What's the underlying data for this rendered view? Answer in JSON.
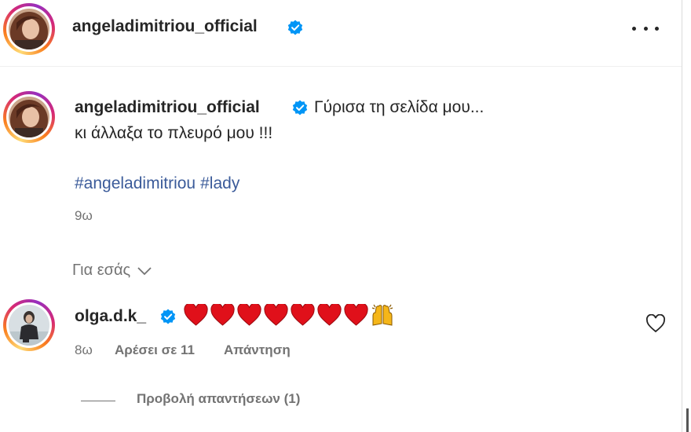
{
  "post": {
    "author": "angeladimitriou_official",
    "more_icon": "more-dots-icon",
    "caption_line1": "Γύρισα τη σελίδα μου...",
    "caption_line2": "κι άλλαξα το πλευρό μου !!!",
    "hashtags": [
      "#angeladimitriou",
      "#lady"
    ],
    "age": "9ω"
  },
  "for_you": {
    "label": "Για εσάς",
    "icon": "chevron-down-icon"
  },
  "comment": {
    "author": "olga.d.k_",
    "emoji": "❤️❤️❤️❤️❤️❤️❤️🙌",
    "age": "8ω",
    "likes": "Αρέσει σε 11",
    "reply": "Απάντηση",
    "view_replies": "Προβολή απαντήσεων (1)",
    "like_icon": "heart-outline-icon"
  },
  "colors": {
    "verified": "#0095f6",
    "hashtag": "#3b5b9a",
    "heart": "#e0101a",
    "muted": "#737373"
  }
}
